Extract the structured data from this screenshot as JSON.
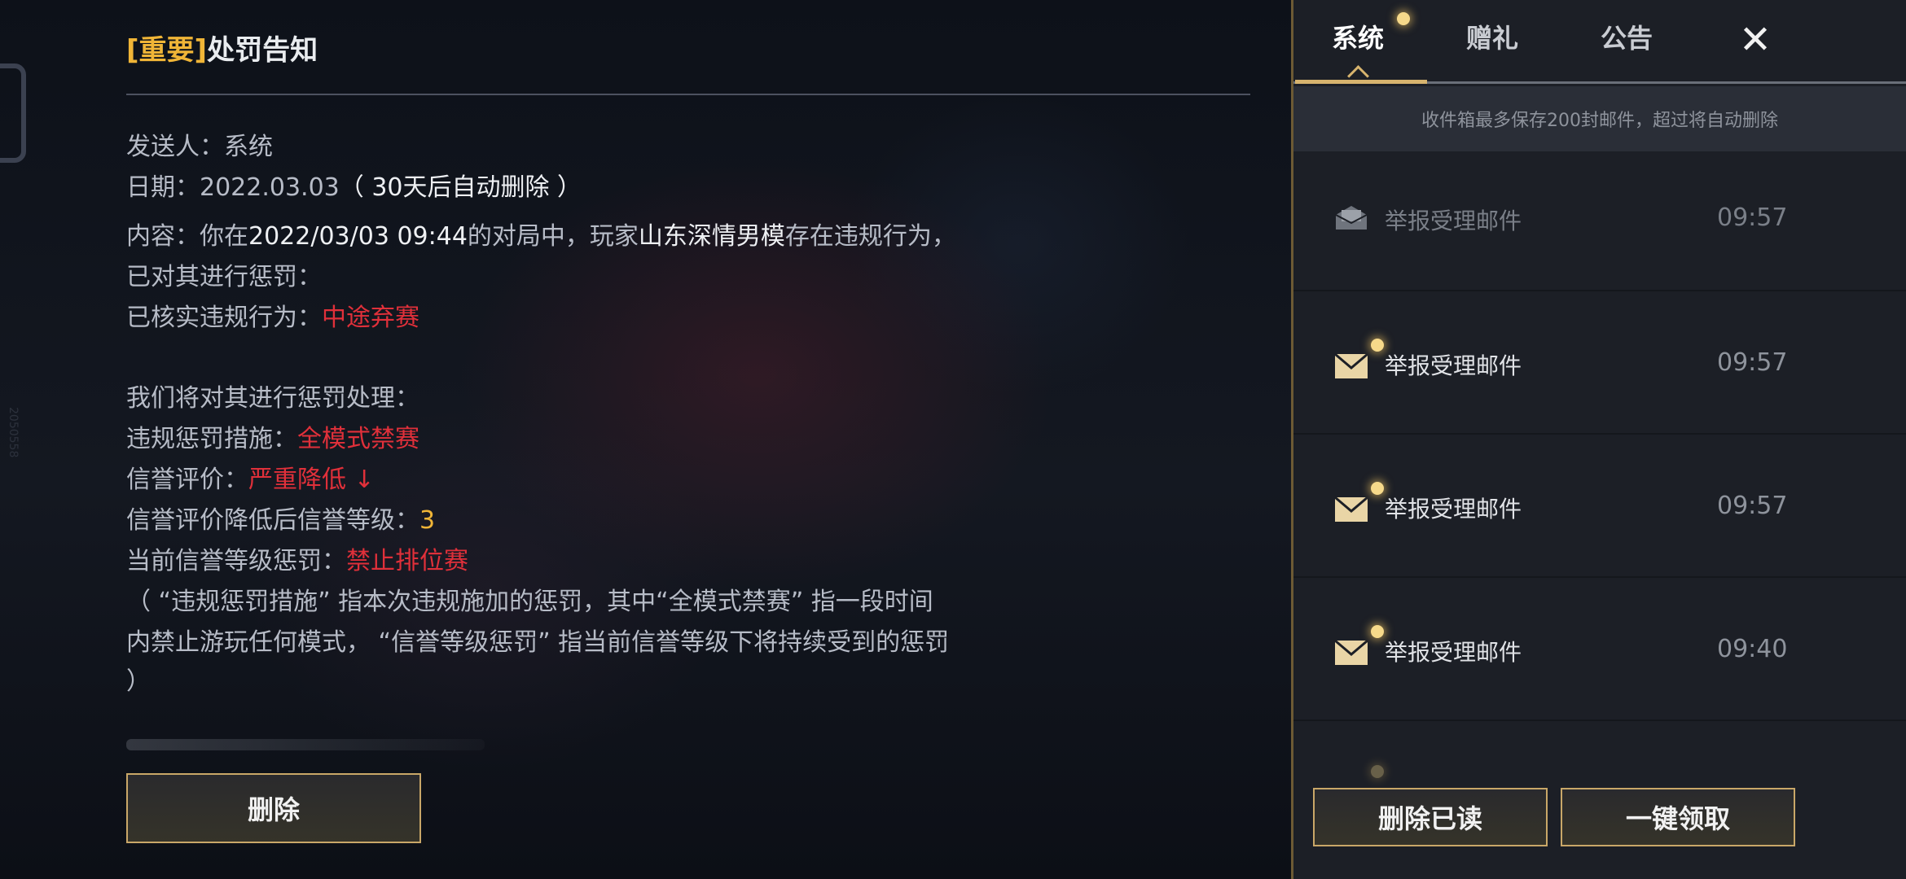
{
  "mail": {
    "title_tag": "[重要]",
    "title": "处罚告知",
    "sender_label": "发送人：",
    "sender": "系统",
    "date_label": "日期：",
    "date": "2022.03.03",
    "date_note": "（ 30天后自动删除 ）",
    "content_label": "内容：",
    "content_1": "你在",
    "content_time": "2022/03/03 09:44",
    "content_2": "的对局中，玩家",
    "player": "山东深情男模",
    "content_3": "存在违规行为，",
    "content_line2": "已对其进行惩罚：",
    "violation_label": "已核实违规行为：",
    "violation": "中途弃赛",
    "handle_intro": "我们将对其进行惩罚处理：",
    "measure_label": "违规惩罚措施：",
    "measure": "全模式禁赛",
    "credit_label": "信誉评价：",
    "credit": "严重降低 ↓",
    "level_label": "信誉评价降低后信誉等级：",
    "level": "3",
    "current_label": "当前信誉等级惩罚：",
    "current": "禁止排位赛",
    "explain_1": "（ “违规惩罚措施” 指本次违规施加的惩罚，其中“全模式禁赛” 指一段时间",
    "explain_2": "内禁止游玩任何模式， “信誉等级惩罚” 指当前信誉等级下将持续受到的惩罚",
    "explain_3": "）",
    "delete_button": "删除"
  },
  "side_text": "2050558",
  "panel": {
    "tabs": [
      "系统",
      "赠礼",
      "公告"
    ],
    "close_icon": "✕",
    "notice": "收件箱最多保存200封邮件，超过将自动删除",
    "items": [
      {
        "label": "举报受理邮件",
        "time": "09:57",
        "read": true,
        "icon": "open-envelope-icon"
      },
      {
        "label": "举报受理邮件",
        "time": "09:57",
        "read": false,
        "icon": "envelope-icon"
      },
      {
        "label": "举报受理邮件",
        "time": "09:57",
        "read": false,
        "icon": "envelope-icon"
      },
      {
        "label": "举报受理邮件",
        "time": "09:40",
        "read": false,
        "icon": "envelope-icon"
      }
    ],
    "delete_read_button": "删除已读",
    "claim_all_button": "一键领取"
  },
  "colors": {
    "accent_gold": "#d7b46e",
    "title_tag": "#f0b537",
    "penalty_red": "#e0303a"
  }
}
